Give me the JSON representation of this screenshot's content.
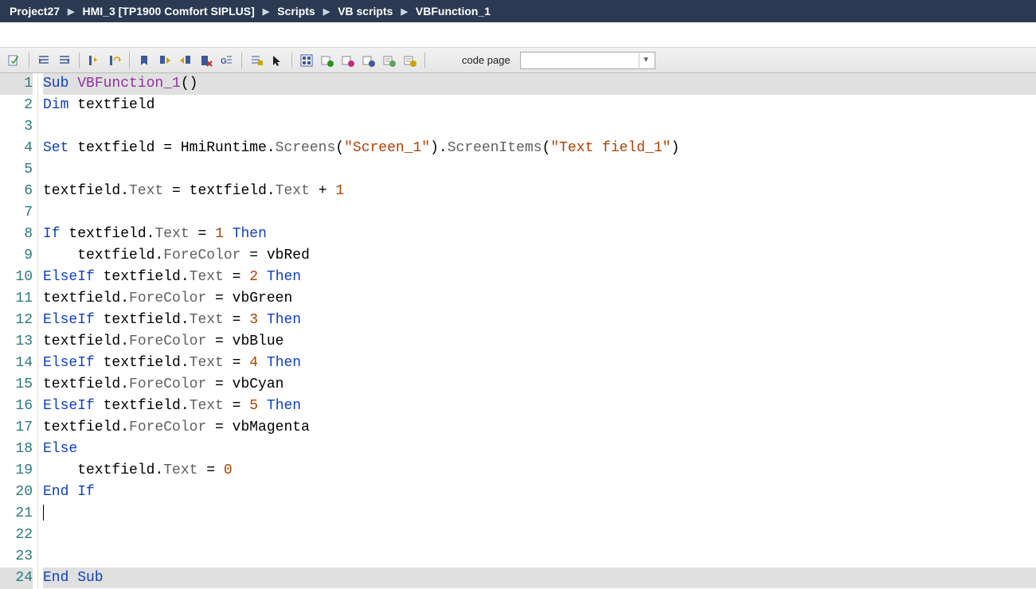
{
  "breadcrumb": {
    "items": [
      "Project27",
      "HMI_3 [TP1900 Comfort SIPLUS]",
      "Scripts",
      "VB scripts",
      "VBFunction_1"
    ]
  },
  "toolbar": {
    "code_page_label": "code page",
    "code_page_value": ""
  },
  "editor": {
    "lines": [
      {
        "n": 1,
        "hl": true,
        "tokens": [
          [
            "kw",
            "Sub"
          ],
          [
            "",
            " "
          ],
          [
            "fn",
            "VBFunction_1"
          ],
          [
            "",
            "()"
          ]
        ]
      },
      {
        "n": 2,
        "hl": false,
        "tokens": [
          [
            "kw",
            "Dim"
          ],
          [
            "",
            " textfield"
          ]
        ]
      },
      {
        "n": 3,
        "hl": false,
        "tokens": [
          [
            "",
            ""
          ]
        ]
      },
      {
        "n": 4,
        "hl": false,
        "tokens": [
          [
            "kw",
            "Set"
          ],
          [
            "",
            " textfield = HmiRuntime."
          ],
          [
            "mem",
            "Screens"
          ],
          [
            "",
            "("
          ],
          [
            "str",
            "\"Screen_1\""
          ],
          [
            "",
            ")."
          ],
          [
            "mem",
            "ScreenItems"
          ],
          [
            "",
            "("
          ],
          [
            "str",
            "\"Text field_1\""
          ],
          [
            "",
            ")"
          ]
        ]
      },
      {
        "n": 5,
        "hl": false,
        "tokens": [
          [
            "",
            ""
          ]
        ]
      },
      {
        "n": 6,
        "hl": false,
        "tokens": [
          [
            "",
            "textfield."
          ],
          [
            "mem",
            "Text"
          ],
          [
            "",
            " = textfield."
          ],
          [
            "mem",
            "Text"
          ],
          [
            "",
            " + "
          ],
          [
            "num",
            "1"
          ]
        ]
      },
      {
        "n": 7,
        "hl": false,
        "tokens": [
          [
            "",
            ""
          ]
        ]
      },
      {
        "n": 8,
        "hl": false,
        "tokens": [
          [
            "kw",
            "If"
          ],
          [
            "",
            " textfield."
          ],
          [
            "mem",
            "Text"
          ],
          [
            "",
            " = "
          ],
          [
            "num",
            "1"
          ],
          [
            "",
            " "
          ],
          [
            "kw",
            "Then"
          ]
        ]
      },
      {
        "n": 9,
        "hl": false,
        "tokens": [
          [
            "",
            "    textfield."
          ],
          [
            "mem",
            "ForeColor"
          ],
          [
            "",
            " = vbRed"
          ]
        ]
      },
      {
        "n": 10,
        "hl": false,
        "tokens": [
          [
            "kw",
            "ElseIf"
          ],
          [
            "",
            " textfield."
          ],
          [
            "mem",
            "Text"
          ],
          [
            "",
            " = "
          ],
          [
            "num",
            "2"
          ],
          [
            "",
            " "
          ],
          [
            "kw",
            "Then"
          ]
        ]
      },
      {
        "n": 11,
        "hl": false,
        "tokens": [
          [
            "",
            "textfield."
          ],
          [
            "mem",
            "ForeColor"
          ],
          [
            "",
            " = vbGreen"
          ]
        ]
      },
      {
        "n": 12,
        "hl": false,
        "tokens": [
          [
            "kw",
            "ElseIf"
          ],
          [
            "",
            " textfield."
          ],
          [
            "mem",
            "Text"
          ],
          [
            "",
            " = "
          ],
          [
            "num",
            "3"
          ],
          [
            "",
            " "
          ],
          [
            "kw",
            "Then"
          ]
        ]
      },
      {
        "n": 13,
        "hl": false,
        "tokens": [
          [
            "",
            "textfield."
          ],
          [
            "mem",
            "ForeColor"
          ],
          [
            "",
            " = vbBlue"
          ]
        ]
      },
      {
        "n": 14,
        "hl": false,
        "tokens": [
          [
            "kw",
            "ElseIf"
          ],
          [
            "",
            " textfield."
          ],
          [
            "mem",
            "Text"
          ],
          [
            "",
            " = "
          ],
          [
            "num",
            "4"
          ],
          [
            "",
            " "
          ],
          [
            "kw",
            "Then"
          ]
        ]
      },
      {
        "n": 15,
        "hl": false,
        "tokens": [
          [
            "",
            "textfield."
          ],
          [
            "mem",
            "ForeColor"
          ],
          [
            "",
            " = vbCyan"
          ]
        ]
      },
      {
        "n": 16,
        "hl": false,
        "tokens": [
          [
            "kw",
            "ElseIf"
          ],
          [
            "",
            " textfield."
          ],
          [
            "mem",
            "Text"
          ],
          [
            "",
            " = "
          ],
          [
            "num",
            "5"
          ],
          [
            "",
            " "
          ],
          [
            "kw",
            "Then"
          ]
        ]
      },
      {
        "n": 17,
        "hl": false,
        "tokens": [
          [
            "",
            "textfield."
          ],
          [
            "mem",
            "ForeColor"
          ],
          [
            "",
            " = vbMagenta"
          ]
        ]
      },
      {
        "n": 18,
        "hl": false,
        "tokens": [
          [
            "kw",
            "Else"
          ]
        ]
      },
      {
        "n": 19,
        "hl": false,
        "tokens": [
          [
            "",
            "    textfield."
          ],
          [
            "mem",
            "Text"
          ],
          [
            "",
            " = "
          ],
          [
            "num",
            "0"
          ]
        ]
      },
      {
        "n": 20,
        "hl": false,
        "tokens": [
          [
            "kw",
            "End If"
          ]
        ]
      },
      {
        "n": 21,
        "hl": false,
        "caret": true,
        "tokens": [
          [
            "",
            ""
          ]
        ]
      },
      {
        "n": 22,
        "hl": false,
        "tokens": [
          [
            "",
            ""
          ]
        ]
      },
      {
        "n": 23,
        "hl": false,
        "tokens": [
          [
            "",
            ""
          ]
        ]
      },
      {
        "n": 24,
        "hl": true,
        "tokens": [
          [
            "kw",
            "End Sub"
          ]
        ]
      }
    ]
  }
}
